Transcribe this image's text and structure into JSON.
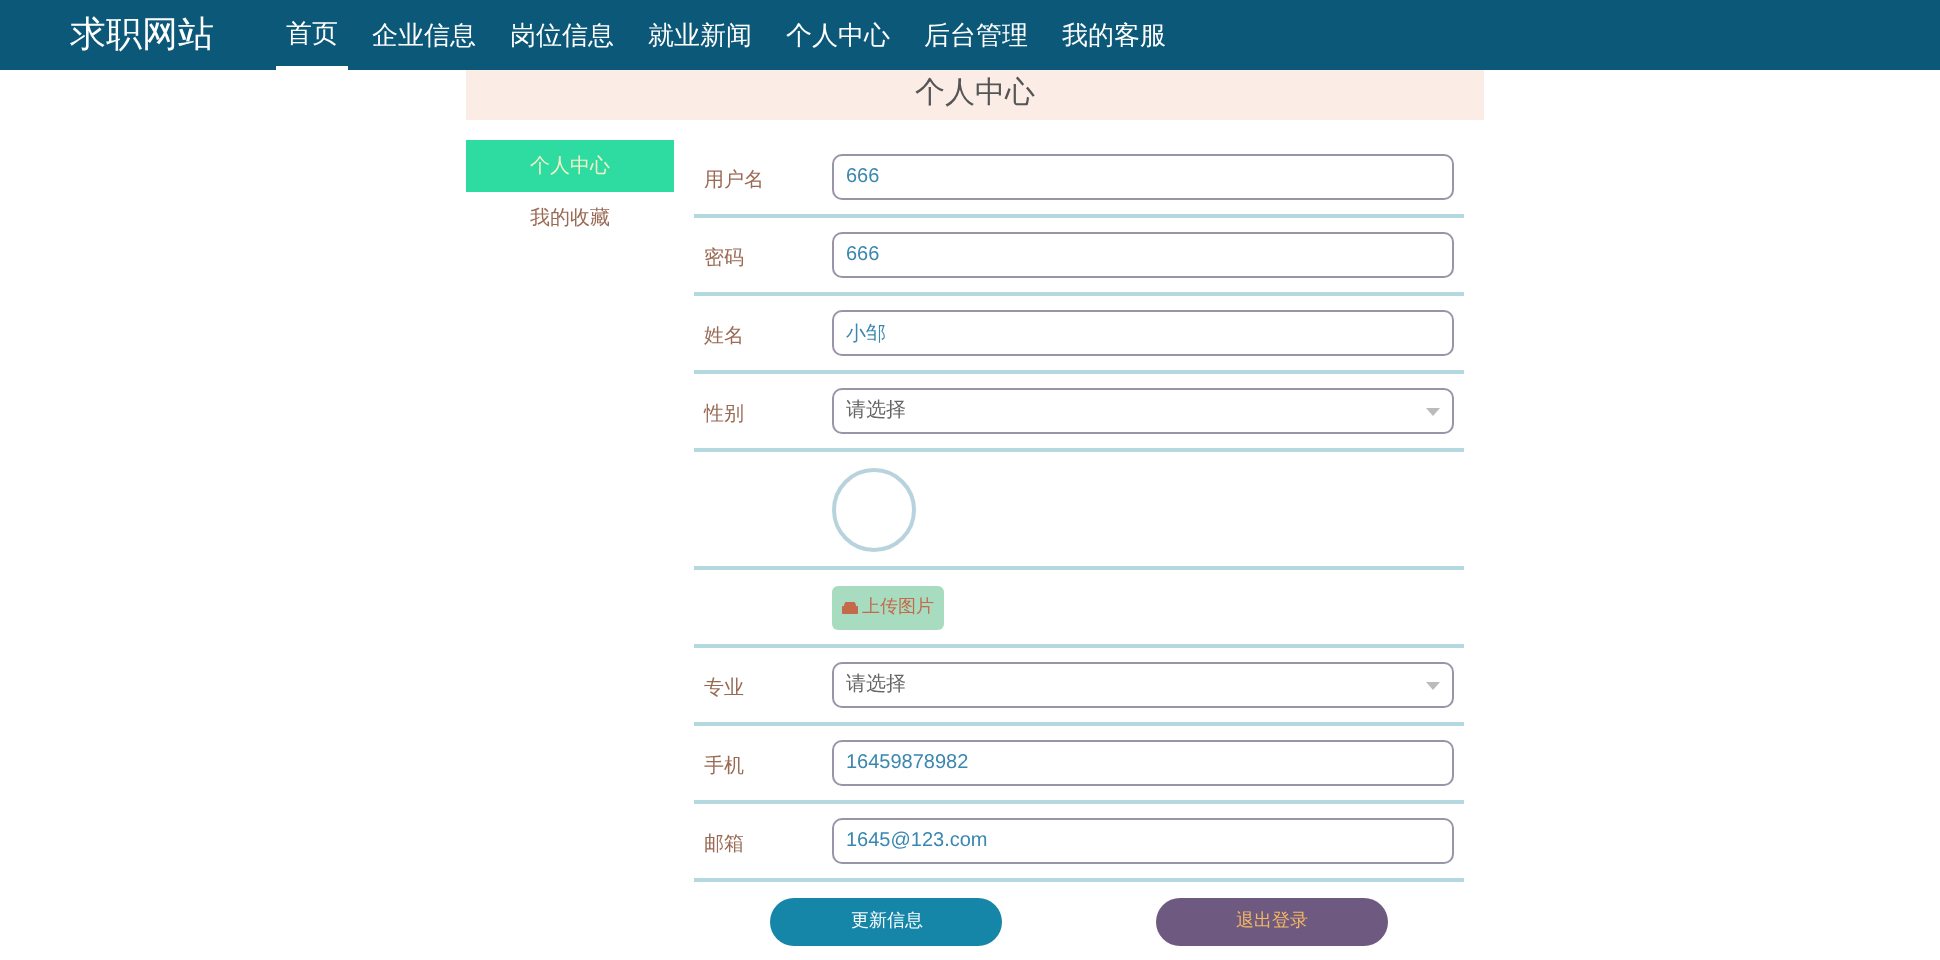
{
  "nav": {
    "brand": "求职网站",
    "items": [
      {
        "label": "首页",
        "selected": true
      },
      {
        "label": "企业信息",
        "selected": false
      },
      {
        "label": "岗位信息",
        "selected": false
      },
      {
        "label": "就业新闻",
        "selected": false
      },
      {
        "label": "个人中心",
        "selected": false
      },
      {
        "label": "后台管理",
        "selected": false
      },
      {
        "label": "我的客服",
        "selected": false
      }
    ]
  },
  "page_title": "个人中心",
  "sidebar": {
    "items": [
      {
        "label": "个人中心",
        "selected": true
      },
      {
        "label": "我的收藏",
        "selected": false
      }
    ]
  },
  "form": {
    "rows": [
      {
        "kind": "text",
        "label": "用户名",
        "value": "666"
      },
      {
        "kind": "text",
        "label": "密码",
        "value": "666"
      },
      {
        "kind": "text",
        "label": "姓名",
        "value": "小邹"
      },
      {
        "kind": "select",
        "label": "性别",
        "placeholder": "请选择"
      },
      {
        "kind": "image"
      },
      {
        "kind": "upload",
        "button": "上传图片"
      },
      {
        "kind": "select",
        "label": "专业",
        "placeholder": "请选择"
      },
      {
        "kind": "text",
        "label": "手机",
        "value": "16459878982"
      },
      {
        "kind": "text",
        "label": "邮箱",
        "value": "1645@123.com"
      }
    ]
  },
  "buttons": [
    {
      "kind": "primary",
      "label": "更新信息"
    },
    {
      "kind": "secondary",
      "label": "退出登录"
    }
  ]
}
